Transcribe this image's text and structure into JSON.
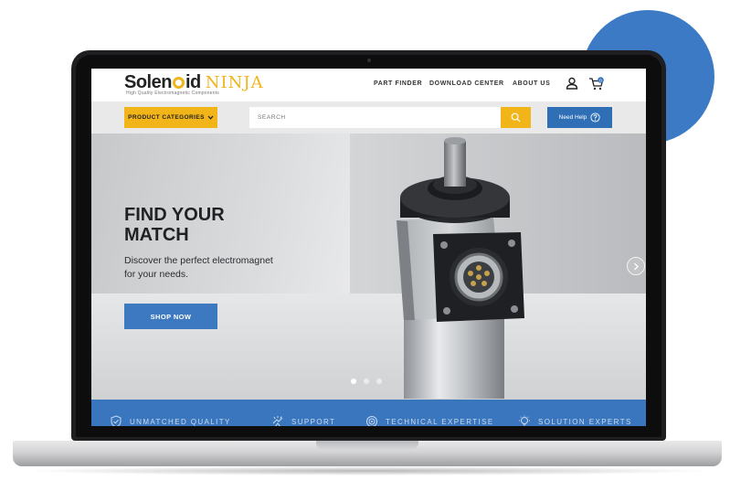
{
  "brand": {
    "name_part1": "Solen",
    "name_part2": "id",
    "name_part3": "NINJA",
    "tagline": "High Quality Electromagnetic Components"
  },
  "nav": {
    "links": [
      "PART FINDER",
      "DOWNLOAD CENTER",
      "ABOUT US"
    ],
    "cart_count": "0"
  },
  "toolbar": {
    "categories_label": "PRODUCT CATEGORIES",
    "search_placeholder": "SEARCH",
    "help_label": "Need Help"
  },
  "hero": {
    "title_line1": "FIND YOUR",
    "title_line2": "MATCH",
    "subtitle_line1": "Discover the perfect electromagnet",
    "subtitle_line2": "for your needs.",
    "cta_label": "SHOP NOW",
    "slide_count": 3,
    "active_slide": 1
  },
  "features": [
    "UNMATCHED QUALITY",
    "SUPPORT",
    "TECHNICAL EXPERTISE",
    "SOLUTION EXPERTS"
  ],
  "colors": {
    "accent_yellow": "#f2b519",
    "brand_blue": "#3a76bd",
    "blob_blue": "#3c7ac6",
    "help_blue": "#2f6fb6"
  }
}
